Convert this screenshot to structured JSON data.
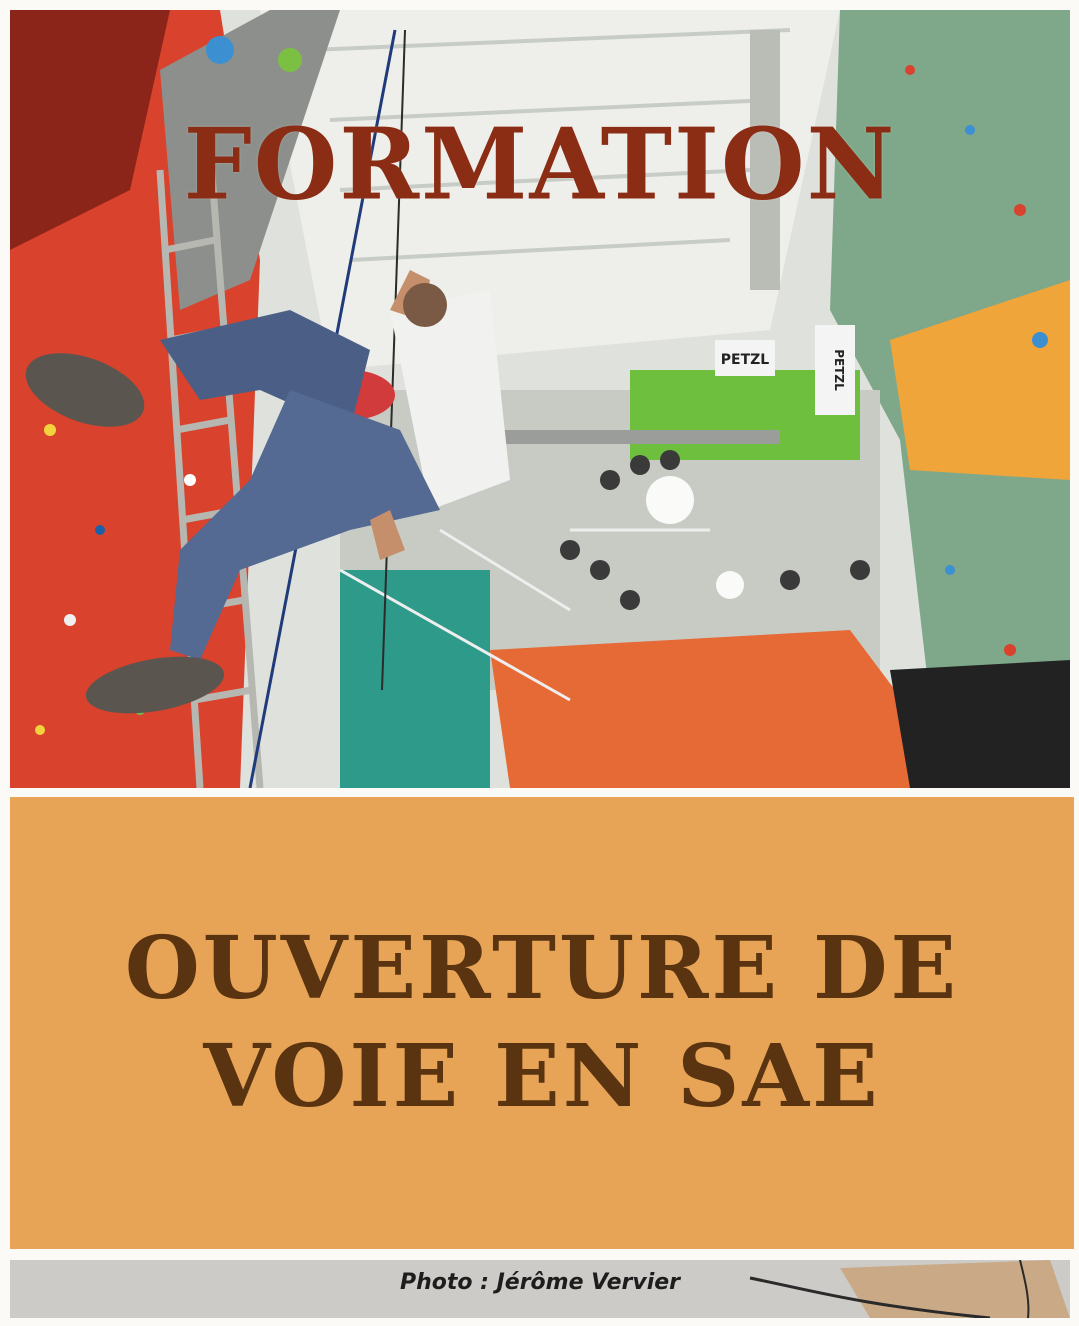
{
  "poster": {
    "title_top": "FORMATION",
    "title_main_line1": "OUVERTURE DE",
    "title_main_line2": "VOIE EN SAE",
    "credit": "Photo : Jérôme Vervier",
    "photo_signs": [
      "PETZL",
      "PETZL"
    ]
  },
  "colors": {
    "title_top": "#8b2d14",
    "panel_background": "#e7a457",
    "panel_text": "#5a3410",
    "frame": "#fbfaf7"
  }
}
